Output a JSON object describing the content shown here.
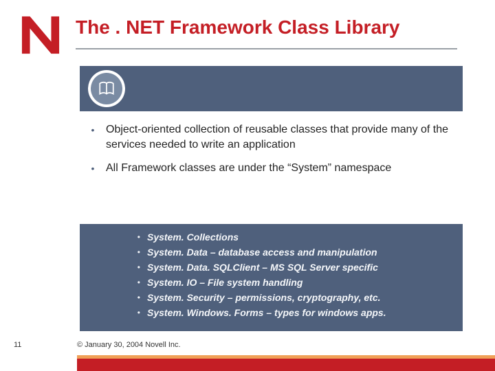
{
  "title": "The . NET Framework Class Library",
  "bullets": [
    "Object-oriented collection of reusable classes that provide many of the services needed to write an application",
    "All Framework classes are under the “System” namespace"
  ],
  "sub_items": [
    "System. Collections",
    "System. Data – database access and manipulation",
    "System. Data. SQLClient – MS SQL Server specific",
    "System. IO – File system handling",
    "System. Security – permissions, cryptography, etc.",
    "System. Windows. Forms – types for windows apps."
  ],
  "page_number": "11",
  "copyright": "© January 30, 2004 Novell Inc."
}
